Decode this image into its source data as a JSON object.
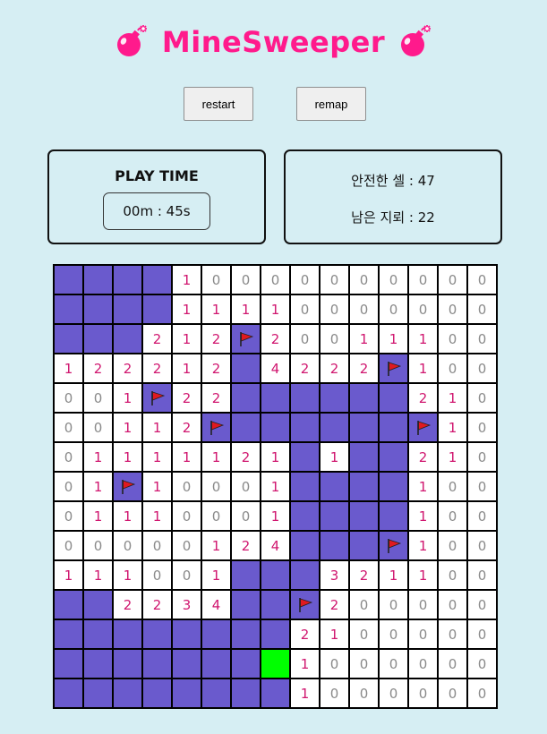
{
  "header": {
    "title": "MineSweeper",
    "title_color": "#ff1a8c",
    "left_icon": "bomb-icon",
    "right_icon": "bomb-icon"
  },
  "buttons": {
    "restart_label": "restart",
    "remap_label": "remap"
  },
  "timer": {
    "label": "PLAY TIME",
    "value": "00m : 45s"
  },
  "info": {
    "safe_cells": "안전한 셀 : 47",
    "remaining_mines": "남은 지뢰 : 22"
  },
  "colors": {
    "background": "#d6eef3",
    "hidden_cell": "#6a5acd",
    "open_cell": "#ffffff",
    "active_cell": "#00ff00",
    "number_color": "#d0166f",
    "zero_color": "#8a8a8a",
    "flag_color": "#e0191f"
  },
  "board": {
    "legend": {
      "H": "hidden",
      "F": "flag",
      "G": "active",
      "digits": "open cell with adjacent mine count"
    },
    "rows": [
      [
        "H",
        "H",
        "H",
        "H",
        "1",
        "0",
        "0",
        "0",
        "0",
        "0",
        "0",
        "0",
        "0",
        "0",
        "0"
      ],
      [
        "H",
        "H",
        "H",
        "H",
        "1",
        "1",
        "1",
        "1",
        "0",
        "0",
        "0",
        "0",
        "0",
        "0",
        "0"
      ],
      [
        "H",
        "H",
        "H",
        "2",
        "1",
        "2",
        "F",
        "2",
        "0",
        "0",
        "1",
        "1",
        "1",
        "0",
        "0"
      ],
      [
        "1",
        "2",
        "2",
        "2",
        "1",
        "2",
        "H",
        "4",
        "2",
        "2",
        "2",
        "F",
        "1",
        "0",
        "0"
      ],
      [
        "0",
        "0",
        "1",
        "F",
        "2",
        "2",
        "H",
        "H",
        "H",
        "H",
        "H",
        "H",
        "2",
        "1",
        "0"
      ],
      [
        "0",
        "0",
        "1",
        "1",
        "2",
        "F",
        "H",
        "H",
        "H",
        "H",
        "H",
        "H",
        "F",
        "1",
        "0"
      ],
      [
        "0",
        "1",
        "1",
        "1",
        "1",
        "1",
        "2",
        "1",
        "H",
        "1",
        "H",
        "H",
        "2",
        "1",
        "0"
      ],
      [
        "0",
        "1",
        "F",
        "1",
        "0",
        "0",
        "0",
        "1",
        "H",
        "H",
        "H",
        "H",
        "1",
        "0",
        "0"
      ],
      [
        "0",
        "1",
        "1",
        "1",
        "0",
        "0",
        "0",
        "1",
        "H",
        "H",
        "H",
        "H",
        "1",
        "0",
        "0"
      ],
      [
        "0",
        "0",
        "0",
        "0",
        "0",
        "1",
        "2",
        "4",
        "H",
        "H",
        "H",
        "F",
        "1",
        "0",
        "0"
      ],
      [
        "1",
        "1",
        "1",
        "0",
        "0",
        "1",
        "H",
        "H",
        "H",
        "3",
        "2",
        "1",
        "1",
        "0",
        "0"
      ],
      [
        "H",
        "H",
        "2",
        "2",
        "3",
        "4",
        "H",
        "H",
        "F",
        "2",
        "0",
        "0",
        "0",
        "0",
        "0"
      ],
      [
        "H",
        "H",
        "H",
        "H",
        "H",
        "H",
        "H",
        "H",
        "2",
        "1",
        "0",
        "0",
        "0",
        "0",
        "0"
      ],
      [
        "H",
        "H",
        "H",
        "H",
        "H",
        "H",
        "H",
        "G",
        "1",
        "0",
        "0",
        "0",
        "0",
        "0",
        "0"
      ],
      [
        "H",
        "H",
        "H",
        "H",
        "H",
        "H",
        "H",
        "H",
        "1",
        "0",
        "0",
        "0",
        "0",
        "0",
        "0"
      ]
    ]
  }
}
